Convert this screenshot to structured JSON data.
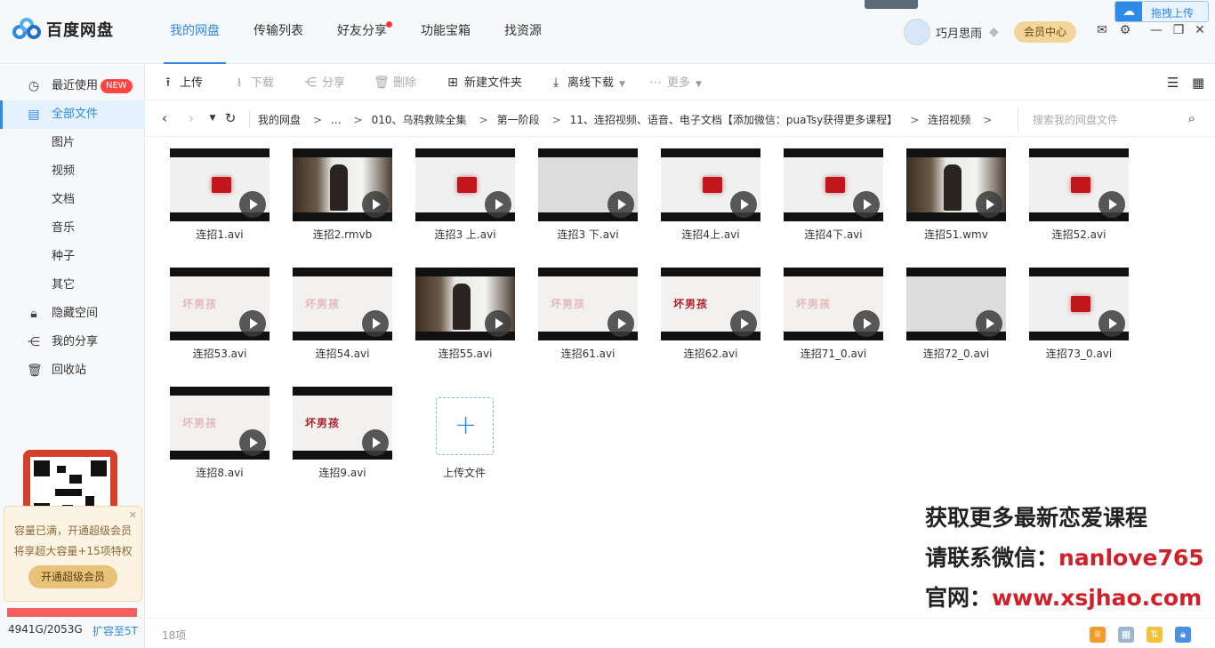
{
  "app": {
    "logo_text": "百度网盘",
    "user_name": "巧月思雨",
    "vip_button": "会员中心",
    "drag_upload": "拖拽上传"
  },
  "nav": {
    "tabs": [
      "我的网盘",
      "传输列表",
      "好友分享",
      "功能宝箱",
      "找资源"
    ]
  },
  "sidebar": {
    "items": [
      {
        "label": "最近使用",
        "badge": "NEW"
      },
      {
        "label": "全部文件"
      },
      {
        "label": "图片"
      },
      {
        "label": "视频"
      },
      {
        "label": "文档"
      },
      {
        "label": "音乐"
      },
      {
        "label": "种子"
      },
      {
        "label": "其它"
      },
      {
        "label": "隐藏空间"
      },
      {
        "label": "我的分享"
      },
      {
        "label": "回收站"
      }
    ],
    "promo_line1": "容量已满，开通超级会员",
    "promo_line2": "将享超大容量+15项特权",
    "promo_button": "开通超级会员",
    "quota_text": "4941G/2053G",
    "expand_link": "扩容至5T"
  },
  "toolbar": {
    "upload": "上传",
    "download": "下载",
    "share": "分享",
    "delete": "删除",
    "new_folder": "新建文件夹",
    "offline": "离线下载",
    "more": "更多"
  },
  "breadcrumb": {
    "path": [
      "我的网盘",
      "...",
      "010、乌鸦救赎全集",
      "第一阶段",
      "11、连招视频、语音、电子文档【添加微信：puaTsy获得更多课程】",
      "连招视频"
    ],
    "search_placeholder": "搜索我的网盘文件"
  },
  "files": [
    {
      "name": "连招1.avi",
      "thumb": "red"
    },
    {
      "name": "连招2.rmvb",
      "thumb": "photo"
    },
    {
      "name": "连招3 上.avi",
      "thumb": "red"
    },
    {
      "name": "连招3 下.avi",
      "thumb": "grey"
    },
    {
      "name": "连招4上.avi",
      "thumb": "red"
    },
    {
      "name": "连招4下.avi",
      "thumb": "red"
    },
    {
      "name": "连招51.wmv",
      "thumb": "photo"
    },
    {
      "name": "连招52.avi",
      "thumb": "red"
    },
    {
      "name": "连招53.avi",
      "thumb": "boy",
      "thumb_text": "坏男孩"
    },
    {
      "name": "连招54.avi",
      "thumb": "boy",
      "thumb_text": "坏男孩"
    },
    {
      "name": "连招55.avi",
      "thumb": "photo"
    },
    {
      "name": "连招61.avi",
      "thumb": "boy",
      "thumb_text": "坏男孩"
    },
    {
      "name": "连招62.avi",
      "thumb": "boy-strong",
      "thumb_text": "坏男孩"
    },
    {
      "name": "连招71_0.avi",
      "thumb": "boy",
      "thumb_text": "坏男孩"
    },
    {
      "name": "连招72_0.avi",
      "thumb": "grey"
    },
    {
      "name": "连招73_0.avi",
      "thumb": "red"
    },
    {
      "name": "连招8.avi",
      "thumb": "boy",
      "thumb_text": "坏男孩"
    },
    {
      "name": "连招9.avi",
      "thumb": "boy-strong",
      "thumb_text": "坏男孩"
    }
  ],
  "upload_tile": {
    "label": "上传文件"
  },
  "watermark": {
    "line1": "获取更多最新恋爱课程",
    "line2_prefix": "请联系微信：",
    "line2_value": "nanlove765",
    "line3_prefix": "官网：",
    "line3_value": "www.xsjhao.com"
  },
  "status": {
    "count": "18项"
  },
  "colors": {
    "accent": "#2e8ae6",
    "badge": "#f44444",
    "vip": "#f3d59a",
    "watermark_red": "#d0202a"
  }
}
